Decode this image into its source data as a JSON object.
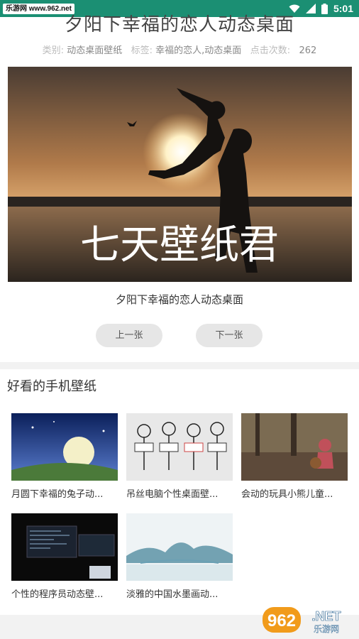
{
  "status": {
    "site": "乐游网 www.962.net",
    "time": "5:01"
  },
  "article": {
    "title": "夕阳下幸福的恋人动态桌面",
    "category_label": "类别:",
    "category_value": "动态桌面壁纸",
    "tags_label": "标签:",
    "tags_value": "幸福的恋人,动态桌面",
    "clicks_label": "点击次数:",
    "clicks_value": "262",
    "image_overlay_text": "七天壁纸君",
    "caption": "夕阳下幸福的恋人动态桌面",
    "prev_label": "上一张",
    "next_label": "下一张"
  },
  "section": {
    "title": "好看的手机壁纸",
    "items": [
      {
        "title": "月圆下幸福的兔子动..."
      },
      {
        "title": "吊丝电脑个性桌面壁..."
      },
      {
        "title": "会动的玩具小熊儿童..."
      },
      {
        "title": "个性的程序员动态壁..."
      },
      {
        "title": "淡雅的中国水墨画动..."
      }
    ]
  },
  "watermark": {
    "text": "962.NET",
    "sub": "乐游网"
  }
}
